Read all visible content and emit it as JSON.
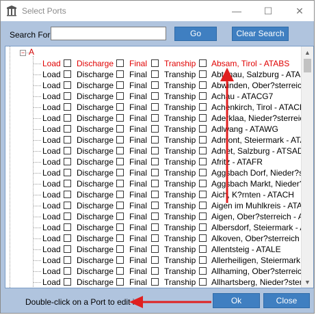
{
  "window": {
    "title": "Select Ports",
    "minimize_glyph": "—",
    "maximize_glyph": "☐",
    "close_glyph": "✕"
  },
  "search": {
    "label": "Search For",
    "value": "",
    "placeholder": "",
    "go_label": "Go",
    "clear_label": "Clear Search"
  },
  "tree": {
    "group_label": "A",
    "collapse_glyph": "−",
    "column_labels": {
      "load": "Load",
      "discharge": "Discharge",
      "final": "Final",
      "tranship": "Tranship"
    },
    "ports": [
      {
        "name": "Absam, Tirol - ATABS",
        "highlighted": true
      },
      {
        "name": "Abtenau, Salzburg - ATABT",
        "highlighted": false
      },
      {
        "name": "Abwinden, Ober?sterreich - A",
        "highlighted": false
      },
      {
        "name": "Achau - ATACG7",
        "highlighted": false
      },
      {
        "name": "Achenkirch, Tirol - ATACK",
        "highlighted": false
      },
      {
        "name": "Aderklaa, Nieder?sterreich - A",
        "highlighted": false
      },
      {
        "name": "Adlwang - ATAWG",
        "highlighted": false
      },
      {
        "name": "Admont, Steiermark - ATADO",
        "highlighted": false
      },
      {
        "name": "Adnet, Salzburg - ATSAD",
        "highlighted": false
      },
      {
        "name": "Afritz - ATAFR",
        "highlighted": false
      },
      {
        "name": "Aggsbach Dorf, Nieder?sterrei",
        "highlighted": false
      },
      {
        "name": "Aggsbach Markt, Nieder?sterr",
        "highlighted": false
      },
      {
        "name": "Aich, K?rnten - ATACH",
        "highlighted": false
      },
      {
        "name": "Aigen im Muhlkreis - ATAIG",
        "highlighted": false
      },
      {
        "name": "Aigen, Ober?sterreich - ATAI",
        "highlighted": false
      },
      {
        "name": "Albersdorf, Steiermark - ATA",
        "highlighted": false
      },
      {
        "name": "Alkoven, Ober?sterreich - ATA",
        "highlighted": false
      },
      {
        "name": "Allentsteig - ATALE",
        "highlighted": false
      },
      {
        "name": "Allerheiligen, Steiermark - AT",
        "highlighted": false
      },
      {
        "name": "Allhaming, Ober?sterreich - A",
        "highlighted": false
      },
      {
        "name": "Allhartsberg, Nieder?sterreic",
        "highlighted": false
      }
    ]
  },
  "footer": {
    "hint": "Double-click on a Port to edit it",
    "ok_label": "Ok",
    "close_label": "Close"
  },
  "colors": {
    "window_bg": "#b0c4de",
    "button_bg": "#3f7fc1",
    "highlight_text": "#e00000",
    "annotation_arrow": "#e02020"
  }
}
